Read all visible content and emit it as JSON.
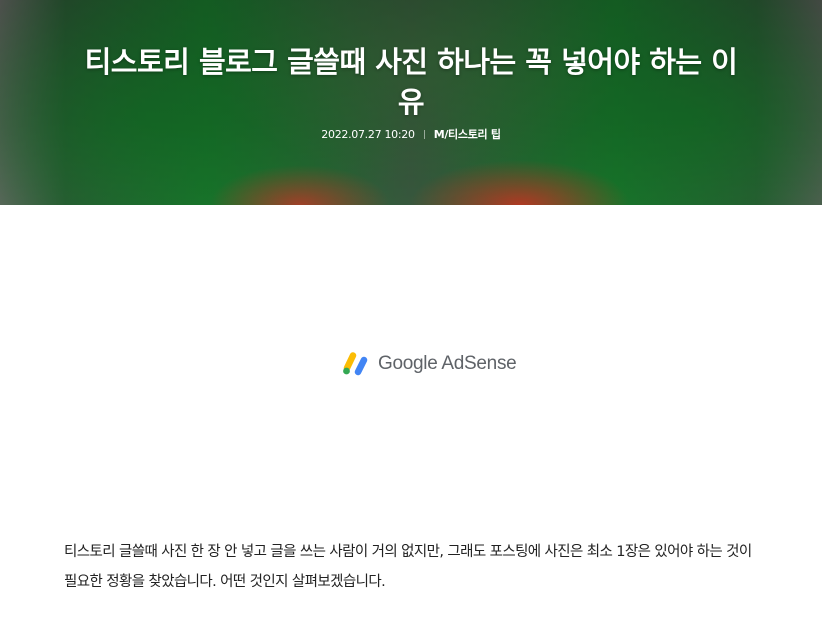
{
  "post": {
    "title": "티스토리 블로그 글쓸때 사진 하나는 꼭 넣어야 하는 이유",
    "date": "2022.07.27 10:20",
    "category": "M/티스토리 팁",
    "body": "티스토리 글쓸때 사진 한 장 안 넣고 글을 쓰는 사람이 거의 없지만, 그래도 포스팅에 사진은 최소 1장은 있어야 하는 것이 필요한 정황을 찾았습니다. 어떤 것인지 살펴보겠습니다."
  },
  "ad": {
    "logo_text": "Google AdSense",
    "logo_icon": "adsense-logo-icon",
    "colors": {
      "yellow": "#FBBC04",
      "blue": "#4285F4",
      "green": "#34A853"
    }
  }
}
